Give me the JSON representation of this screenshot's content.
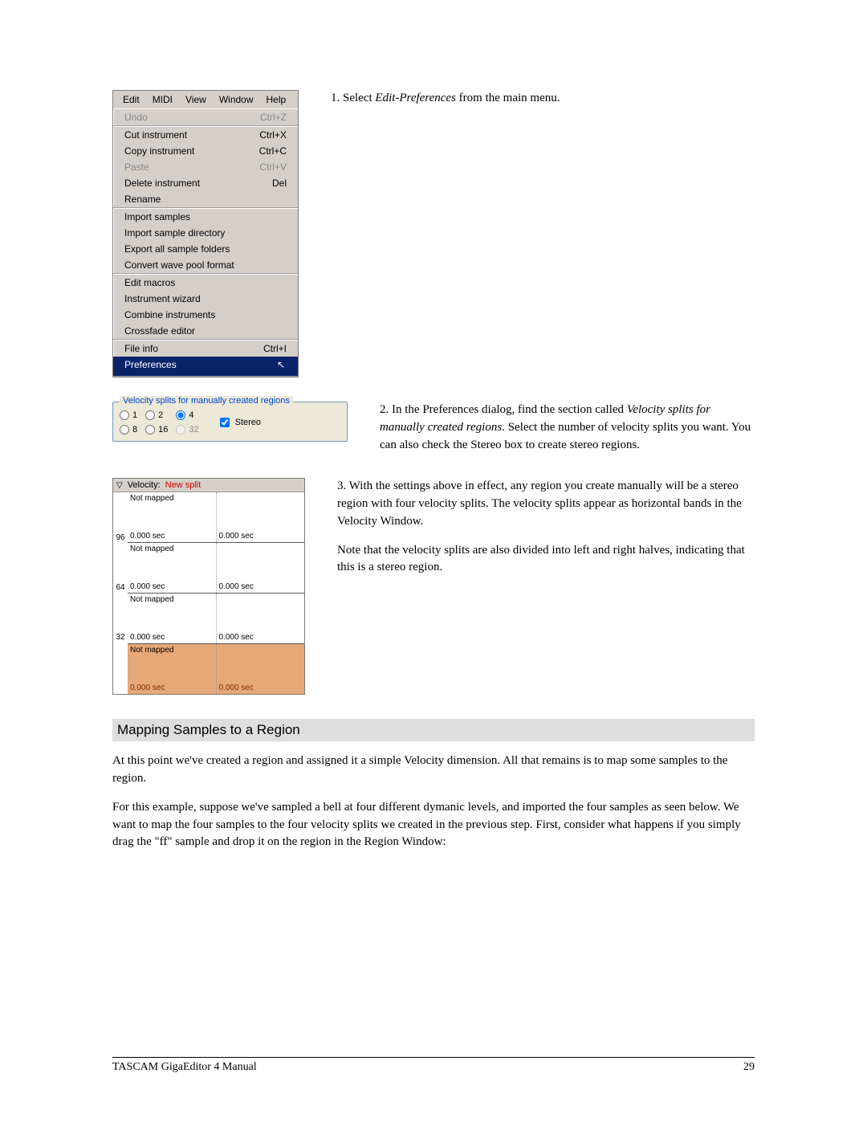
{
  "menubar": [
    "Edit",
    "MIDI",
    "View",
    "Window",
    "Help"
  ],
  "menu": {
    "g1": [
      {
        "label": "Undo",
        "short": "Ctrl+Z",
        "disabled": true
      }
    ],
    "g2": [
      {
        "label": "Cut instrument",
        "short": "Ctrl+X"
      },
      {
        "label": "Copy instrument",
        "short": "Ctrl+C"
      },
      {
        "label": "Paste",
        "short": "Ctrl+V",
        "disabled": true
      },
      {
        "label": "Delete instrument",
        "short": "Del"
      },
      {
        "label": "Rename",
        "short": ""
      }
    ],
    "g3": [
      {
        "label": "Import samples",
        "short": ""
      },
      {
        "label": "Import sample directory",
        "short": ""
      },
      {
        "label": "Export all sample folders",
        "short": ""
      },
      {
        "label": "Convert wave pool format",
        "short": ""
      }
    ],
    "g4": [
      {
        "label": "Edit macros",
        "short": ""
      },
      {
        "label": "Instrument wizard",
        "short": ""
      },
      {
        "label": "Combine instruments",
        "short": ""
      },
      {
        "label": "Crossfade editor",
        "short": ""
      }
    ],
    "g5": [
      {
        "label": "File info",
        "short": "Ctrl+I"
      },
      {
        "label": "Preferences",
        "short": "",
        "selected": true
      }
    ]
  },
  "step1": {
    "prefix": "1. Select ",
    "em": "Edit-Preferences",
    "suffix": " from the main menu."
  },
  "groupbox": {
    "title": "Velocity splits for manually created regions",
    "r1": "1",
    "r2": "2",
    "r4": "4",
    "r8": "8",
    "r16": "16",
    "r32": "32",
    "stereo": "Stereo"
  },
  "step2": {
    "a": "2. In the Preferences dialog, find the section called ",
    "em": "Velocity splits for manually created regions",
    "b": ".  Select the number of velocity splits you want.  You can also check the Stereo box to create stereo regions."
  },
  "velwin": {
    "tri": "▽",
    "label": "Velocity:",
    "new": "New split",
    "not_mapped": "Not mapped",
    "t": "0.000 sec",
    "r96": "96",
    "r64": "64",
    "r32": "32"
  },
  "step3": {
    "a": "3. With the settings above in effect, any region you create manually will be a stereo region with four velocity splits.  The velocity splits appear as horizontal bands in the Velocity Window.",
    "b": "Note that the velocity splits are also divided into left and right halves, indicating that this is a stereo region."
  },
  "heading": "Mapping Samples to a Region",
  "para1": "At this point we've created a region and assigned it a simple Velocity dimension.  All that remains is to map some samples to the region.",
  "para2": "For this example, suppose we've sampled a bell at four different dymanic levels, and imported the four samples as seen below.  We want to map the four samples to the four velocity splits we created in the previous step.  First, consider what happens if you simply drag the \"ff\" sample and drop it on the region in the Region Window:",
  "footer": {
    "left": "TASCAM GigaEditor 4 Manual",
    "right": "29"
  }
}
